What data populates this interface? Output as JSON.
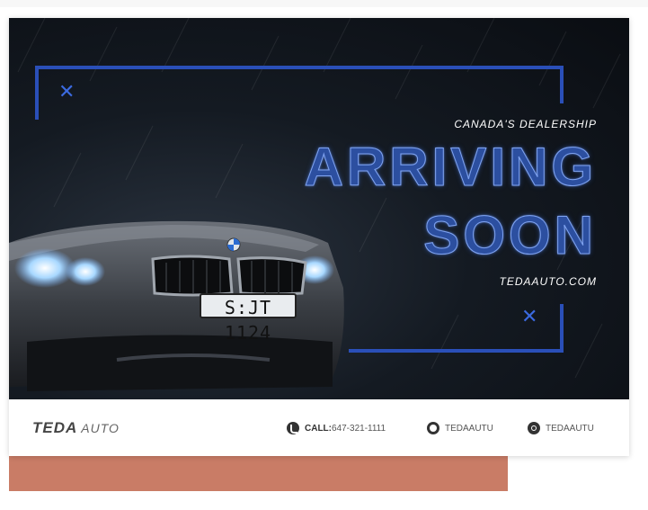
{
  "hero": {
    "tagline": "CANADA'S DEALERSHIP",
    "headline_line1": "ARRIVING",
    "headline_line2": "SOON",
    "website": "TEDAAUTO.COM",
    "license_plate": "S:JT 1124"
  },
  "footer": {
    "brand_name": "TEDA",
    "brand_suffix": "AUTO",
    "call_label": "CALL:",
    "phone_number": "647-321-1111",
    "social_handle_1": "TEDAAUTU",
    "social_handle_2": "TEDAAUTU"
  },
  "colors": {
    "frame_blue": "#2a4fb8",
    "headline_blue": "#2c4fa0",
    "accent_block": "#c97c66",
    "hero_background": "#0a0d12"
  },
  "icons": [
    "close-x-icon",
    "phone-icon",
    "chat-icon",
    "camera-icon"
  ]
}
